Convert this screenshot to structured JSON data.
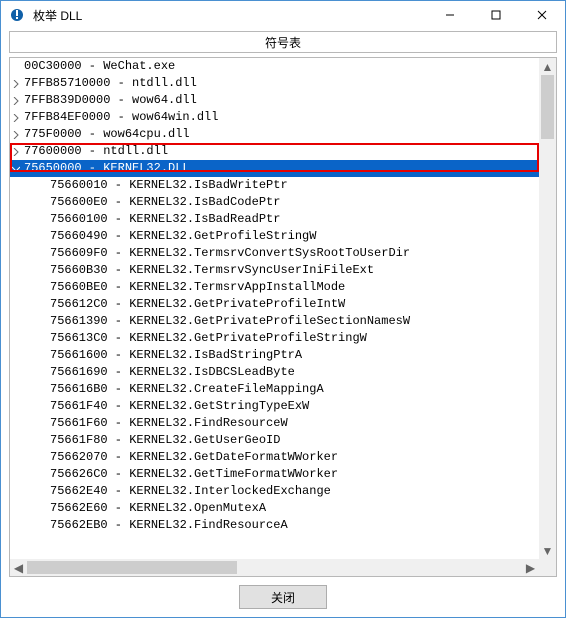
{
  "window": {
    "title": "枚举 DLL",
    "subtitle": "符号表",
    "close_button": "关闭"
  },
  "icons": {
    "app": "app-icon",
    "minimize": "minimize",
    "maximize": "maximize",
    "close": "close",
    "caret_right": "›",
    "caret_down": "⌄",
    "up": "▲",
    "down": "▼",
    "left": "◀",
    "right": "▶"
  },
  "colors": {
    "selection": "#0a64c8",
    "highlight_border": "#e60000",
    "window_border": "#4a90d1"
  },
  "list": {
    "items": [
      {
        "expander": "none",
        "indent": 0,
        "text": "00C30000 - WeChat.exe",
        "selected": false
      },
      {
        "expander": "right",
        "indent": 0,
        "text": "7FFB85710000 - ntdll.dll",
        "selected": false
      },
      {
        "expander": "right",
        "indent": 0,
        "text": "7FFB839D0000 - wow64.dll",
        "selected": false
      },
      {
        "expander": "right",
        "indent": 0,
        "text": "7FFB84EF0000 - wow64win.dll",
        "selected": false
      },
      {
        "expander": "right",
        "indent": 0,
        "text": "775F0000 - wow64cpu.dll",
        "selected": false
      },
      {
        "expander": "right",
        "indent": 0,
        "text": "77600000 - ntdll.dll",
        "selected": false
      },
      {
        "expander": "down",
        "indent": 0,
        "text": "75650000 - KERNEL32.DLL",
        "selected": true
      },
      {
        "expander": "none",
        "indent": 1,
        "text": "75660010 - KERNEL32.IsBadWritePtr",
        "selected": false
      },
      {
        "expander": "none",
        "indent": 1,
        "text": "756600E0 - KERNEL32.IsBadCodePtr",
        "selected": false
      },
      {
        "expander": "none",
        "indent": 1,
        "text": "75660100 - KERNEL32.IsBadReadPtr",
        "selected": false
      },
      {
        "expander": "none",
        "indent": 1,
        "text": "75660490 - KERNEL32.GetProfileStringW",
        "selected": false
      },
      {
        "expander": "none",
        "indent": 1,
        "text": "756609F0 - KERNEL32.TermsrvConvertSysRootToUserDir",
        "selected": false
      },
      {
        "expander": "none",
        "indent": 1,
        "text": "75660B30 - KERNEL32.TermsrvSyncUserIniFileExt",
        "selected": false
      },
      {
        "expander": "none",
        "indent": 1,
        "text": "75660BE0 - KERNEL32.TermsrvAppInstallMode",
        "selected": false
      },
      {
        "expander": "none",
        "indent": 1,
        "text": "756612C0 - KERNEL32.GetPrivateProfileIntW",
        "selected": false
      },
      {
        "expander": "none",
        "indent": 1,
        "text": "75661390 - KERNEL32.GetPrivateProfileSectionNamesW",
        "selected": false
      },
      {
        "expander": "none",
        "indent": 1,
        "text": "756613C0 - KERNEL32.GetPrivateProfileStringW",
        "selected": false
      },
      {
        "expander": "none",
        "indent": 1,
        "text": "75661600 - KERNEL32.IsBadStringPtrA",
        "selected": false
      },
      {
        "expander": "none",
        "indent": 1,
        "text": "75661690 - KERNEL32.IsDBCSLeadByte",
        "selected": false
      },
      {
        "expander": "none",
        "indent": 1,
        "text": "756616B0 - KERNEL32.CreateFileMappingA",
        "selected": false
      },
      {
        "expander": "none",
        "indent": 1,
        "text": "75661F40 - KERNEL32.GetStringTypeExW",
        "selected": false
      },
      {
        "expander": "none",
        "indent": 1,
        "text": "75661F60 - KERNEL32.FindResourceW",
        "selected": false
      },
      {
        "expander": "none",
        "indent": 1,
        "text": "75661F80 - KERNEL32.GetUserGeoID",
        "selected": false
      },
      {
        "expander": "none",
        "indent": 1,
        "text": "75662070 - KERNEL32.GetDateFormatWWorker",
        "selected": false
      },
      {
        "expander": "none",
        "indent": 1,
        "text": "756626C0 - KERNEL32.GetTimeFormatWWorker",
        "selected": false
      },
      {
        "expander": "none",
        "indent": 1,
        "text": "75662E40 - KERNEL32.InterlockedExchange",
        "selected": false
      },
      {
        "expander": "none",
        "indent": 1,
        "text": "75662E60 - KERNEL32.OpenMutexA",
        "selected": false
      },
      {
        "expander": "none",
        "indent": 1,
        "text": "75662EB0 - KERNEL32.FindResourceA",
        "selected": false
      }
    ]
  },
  "highlight": {
    "top_row": 5,
    "height_rows": 1.7
  }
}
